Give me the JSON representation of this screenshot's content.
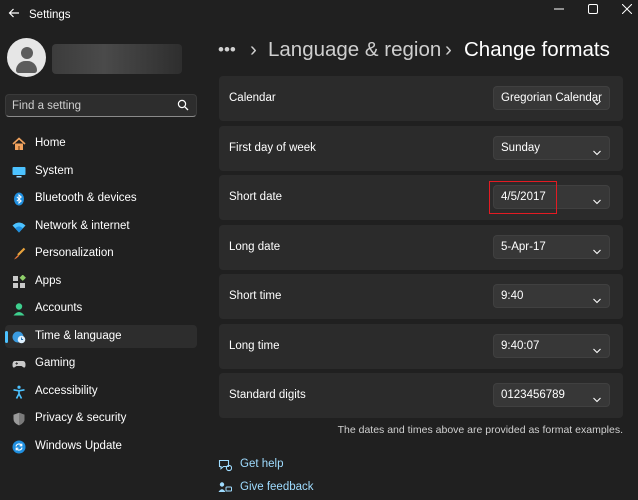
{
  "app": {
    "title": "Settings"
  },
  "search": {
    "placeholder": "Find a setting"
  },
  "sidebar": {
    "items": [
      {
        "label": "Home",
        "icon": "home-icon"
      },
      {
        "label": "System",
        "icon": "system-icon"
      },
      {
        "label": "Bluetooth & devices",
        "icon": "bluetooth-icon"
      },
      {
        "label": "Network & internet",
        "icon": "wifi-icon"
      },
      {
        "label": "Personalization",
        "icon": "brush-icon"
      },
      {
        "label": "Apps",
        "icon": "apps-icon"
      },
      {
        "label": "Accounts",
        "icon": "accounts-icon"
      },
      {
        "label": "Time & language",
        "icon": "clock-globe-icon",
        "active": true
      },
      {
        "label": "Gaming",
        "icon": "gamepad-icon"
      },
      {
        "label": "Accessibility",
        "icon": "accessibility-icon"
      },
      {
        "label": "Privacy & security",
        "icon": "shield-icon"
      },
      {
        "label": "Windows Update",
        "icon": "update-icon"
      }
    ]
  },
  "breadcrumb": {
    "more": "•••",
    "sep": "›",
    "parent": "Language & region",
    "current": "Change formats"
  },
  "formats": [
    {
      "label": "Calendar",
      "value": "Gregorian Calendar"
    },
    {
      "label": "First day of week",
      "value": "Sunday"
    },
    {
      "label": "Short date",
      "value": "4/5/2017"
    },
    {
      "label": "Long date",
      "value": "5-Apr-17"
    },
    {
      "label": "Short time",
      "value": "9:40"
    },
    {
      "label": "Long time",
      "value": "9:40:07"
    },
    {
      "label": "Standard digits",
      "value": "0123456789"
    }
  ],
  "footnote": "The dates and times above are provided as format examples.",
  "links": {
    "help": "Get help",
    "feedback": "Give feedback"
  },
  "colors": {
    "accent": "#4cc2ff",
    "highlight": "#e31b23",
    "link": "#9fdcff",
    "background": "#202020",
    "card": "#2b2b2b"
  }
}
